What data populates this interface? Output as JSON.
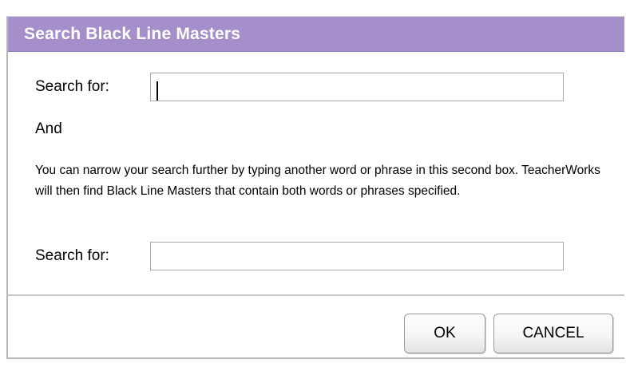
{
  "dialog": {
    "title": "Search Black Line Masters",
    "colors": {
      "titlebar": "#a58fca",
      "title_text": "#ffffff"
    }
  },
  "search1": {
    "label": "Search for:",
    "value": "",
    "focused": true
  },
  "and_label": "And",
  "help_text": "You can narrow your search further by typing another word or phrase in this second box. TeacherWorks will then find Black Line Masters that contain both words or phrases specified.",
  "search2": {
    "label": "Search for:",
    "value": ""
  },
  "buttons": {
    "ok": "OK",
    "cancel": "CANCEL"
  }
}
